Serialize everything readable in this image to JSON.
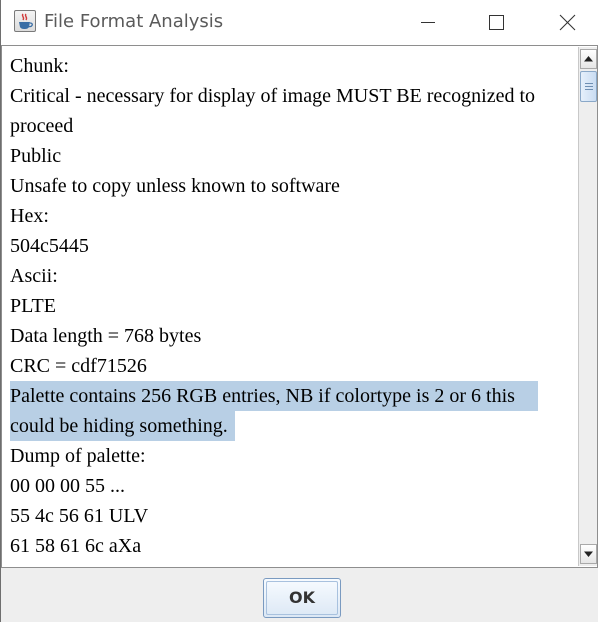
{
  "window": {
    "title": "File Format Analysis",
    "icon": "java-cup-icon"
  },
  "title_buttons": {
    "minimize_icon": "minimize-icon",
    "maximize_icon": "maximize-icon",
    "close_icon": "close-icon"
  },
  "content": {
    "lines": [
      "Chunk:",
      "Critical - necessary for display of image MUST BE recognized to",
      "proceed",
      "Public",
      "Unsafe to copy unless known to software",
      "Hex:",
      "504c5445",
      "Ascii:",
      "PLTE",
      "Data length = 768 bytes",
      "CRC = cdf71526",
      "Palette contains 256 RGB entries, NB if colortype is 2 or 6 this",
      "could be hiding something.",
      "Dump of palette:",
      "00 00 00 55 ...",
      "55 4c 56 61 ULV",
      "61 58 61 6c aXa"
    ],
    "selection_color": "#b8cfe5"
  },
  "scrollbar": {
    "up_icon": "arrow-up-icon",
    "down_icon": "arrow-down-icon",
    "thumb_position_fraction": 0.0
  },
  "footer": {
    "ok_label": "OK"
  }
}
